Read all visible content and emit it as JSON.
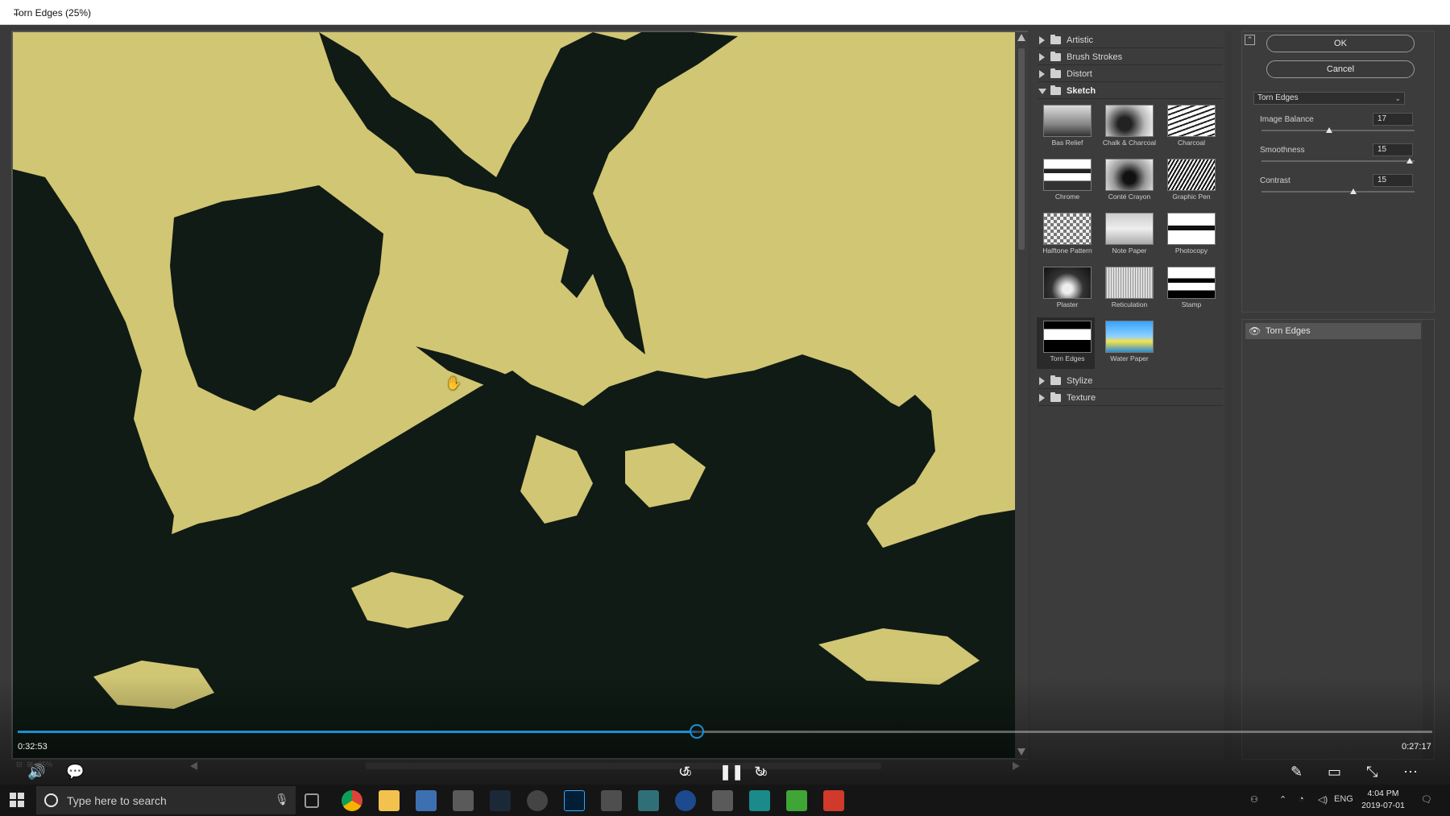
{
  "window": {
    "title": "Torn Edges (25%)"
  },
  "canvas": {
    "zoom": "25%",
    "foreground": "#0f1b14",
    "background": "#d1c674"
  },
  "gallery": {
    "categories_top": [
      {
        "label": "Artistic"
      },
      {
        "label": "Brush Strokes"
      },
      {
        "label": "Distort"
      }
    ],
    "open_category": "Sketch",
    "filters": [
      {
        "label": "Bas Relief"
      },
      {
        "label": "Chalk & Charcoal"
      },
      {
        "label": "Charcoal"
      },
      {
        "label": "Chrome"
      },
      {
        "label": "Conté Crayon"
      },
      {
        "label": "Graphic Pen"
      },
      {
        "label": "Halftone Pattern"
      },
      {
        "label": "Note Paper"
      },
      {
        "label": "Photocopy"
      },
      {
        "label": "Plaster"
      },
      {
        "label": "Reticulation"
      },
      {
        "label": "Stamp"
      },
      {
        "label": "Torn Edges"
      },
      {
        "label": "Water Paper"
      }
    ],
    "selected_filter": "Torn Edges",
    "categories_bottom": [
      {
        "label": "Stylize"
      },
      {
        "label": "Texture"
      }
    ]
  },
  "settings": {
    "ok_label": "OK",
    "cancel_label": "Cancel",
    "filter_select": "Torn Edges",
    "sliders": [
      {
        "label": "Image Balance",
        "value": "17",
        "fraction": 0.44
      },
      {
        "label": "Smoothness",
        "value": "15",
        "fraction": 0.97
      },
      {
        "label": "Contrast",
        "value": "15",
        "fraction": 0.6
      }
    ]
  },
  "layers": {
    "items": [
      {
        "label": "Torn Edges"
      }
    ]
  },
  "video": {
    "elapsed": "0:32:53",
    "remaining": "0:27:17",
    "progress": 0.48,
    "skip_back": "10",
    "skip_forward": "30"
  },
  "taskbar": {
    "search_placeholder": "Type here to search",
    "language": "ENG",
    "time": "4:04 PM",
    "date": "2019-07-01"
  }
}
